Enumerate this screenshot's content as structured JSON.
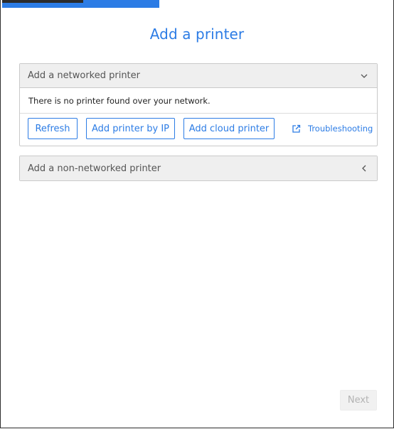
{
  "progress": {
    "fraction": 0.4,
    "color": "#2c7ce5"
  },
  "title": "Add a printer",
  "networked": {
    "header": "Add a networked printer",
    "expanded": true,
    "message": "There is no printer found over your network.",
    "buttons": {
      "refresh": "Refresh",
      "add_by_ip": "Add printer by IP",
      "add_cloud": "Add cloud printer"
    },
    "troubleshooting": "Troubleshooting"
  },
  "non_networked": {
    "header": "Add a non-networked printer",
    "expanded": false
  },
  "footer": {
    "next_label": "Next",
    "next_enabled": false
  },
  "colors": {
    "accent": "#2c7ce5",
    "header_bg": "#efefef",
    "border": "#c9c9c9"
  },
  "icons": {
    "networked_toggle": "chevron-down-icon",
    "non_networked_toggle": "chevron-left-icon",
    "troubleshooting": "external-link-icon"
  }
}
